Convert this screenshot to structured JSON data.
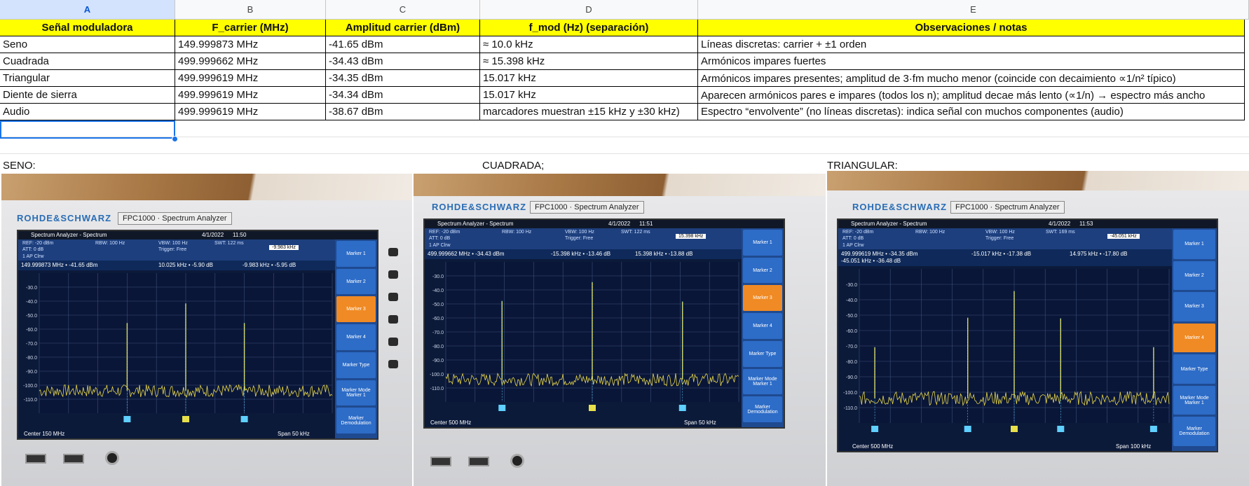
{
  "sheet": {
    "columns": [
      "A",
      "B",
      "C",
      "D",
      "E"
    ],
    "headers": [
      "Señal moduladora",
      "F_carrier (MHz)",
      "Amplitud carrier (dBm)",
      "f_mod (Hz) (separación)",
      "Observaciones / notas"
    ],
    "rows": [
      [
        "Seno",
        "149.999873 MHz",
        "-41.65 dBm",
        "≈ 10.0 kHz",
        "Líneas discretas: carrier + ±1 orden"
      ],
      [
        "Cuadrada",
        "499.999662 MHz",
        "-34.43 dBm",
        "≈ 15.398 kHz",
        "Armónicos impares fuertes"
      ],
      [
        "Triangular",
        "499.999619 MHz",
        "-34.35 dBm",
        "15.017 kHz",
        "Armónicos impares presentes; amplitud de 3·fm mucho menor (coincide con decaimiento ∝1/n² típico)"
      ],
      [
        "Diente de sierra",
        "499.999619 MHz",
        "-34.34 dBm",
        "15.017 kHz",
        "Aparecen armónicos pares e impares (todos los n); amplitud decae más lento (∝1/n) → espectro más ancho"
      ],
      [
        "Audio",
        "499.999619 MHz",
        "-38.67 dBm",
        "marcadores muestran ±15 kHz y ±30 kHz)",
        "Espectro “envolvente” (no líneas discretas): indica señal con muchos componentes (audio)"
      ]
    ],
    "captions": [
      "SENO:",
      "CUADRADA;",
      "TRIANGULAR:"
    ]
  },
  "photos": [
    {
      "brand": "ROHDE&SCHWARZ",
      "model": "FPC1000 · Spectrum Analyzer",
      "title": "Spectrum Analyzer - Spectrum",
      "date": "4/1/2022",
      "time": "11:50",
      "ref": "-20 dBm",
      "att": "0 dB",
      "rbw": "100 Hz",
      "vbw": "100 Hz",
      "swt": "122 ms",
      "trigger": "Free",
      "trace": "1 AP Clrw",
      "marker_readout": "149.999873 MHz • -41.65 dBm",
      "delta2": "10.025 kHz • -5.90 dB",
      "delta3": "-9.983 kHz • -5.95 dB",
      "field": "-9.983 kHz",
      "center": "Center 150 MHz",
      "span": "Span 50 kHz",
      "yticks": [
        "-30.0",
        "-40.0",
        "-50.0",
        "-60.0",
        "-70.0",
        "-80.0",
        "-90.0",
        "-100.0",
        "-110.0"
      ],
      "menu": [
        "Marker 1",
        "Marker 2",
        "Marker 3",
        "Marker 4",
        "Marker Type",
        "Marker Mode Marker 1",
        "Marker Demodulation"
      ],
      "active": 2,
      "peaks_dbm": [
        -55.6,
        -41.65,
        -55.6
      ],
      "peak_offsets_khz": [
        -10,
        0,
        10
      ],
      "span_khz": 50
    },
    {
      "brand": "ROHDE&SCHWARZ",
      "model": "FPC1000 · Spectrum Analyzer",
      "title": "Spectrum Analyzer - Spectrum",
      "date": "4/1/2022",
      "time": "11:51",
      "ref": "-20 dBm",
      "att": "0 dB",
      "rbw": "100 Hz",
      "vbw": "100 Hz",
      "swt": "122 ms",
      "trigger": "Free",
      "trace": "1 AP Clrw",
      "marker_readout": "499.999662 MHz • -34.43 dBm",
      "delta2": "-15.398 kHz • -13.46 dB",
      "delta3": "15.398 kHz • -13.88 dB",
      "field": "15.398 kHz",
      "center": "Center 500 MHz",
      "span": "Span 50 kHz",
      "yticks": [
        "-30.0",
        "-40.0",
        "-50.0",
        "-60.0",
        "-70.0",
        "-80.0",
        "-90.0",
        "-100.0",
        "-110.0"
      ],
      "menu": [
        "Marker 1",
        "Marker 2",
        "Marker 3",
        "Marker 4",
        "Marker Type",
        "Marker Mode Marker 1",
        "Marker Demodulation"
      ],
      "active": 2,
      "peaks_dbm": [
        -47.9,
        -34.43,
        -48.3
      ],
      "peak_offsets_khz": [
        -15.4,
        0,
        15.4
      ],
      "span_khz": 50
    },
    {
      "brand": "ROHDE&SCHWARZ",
      "model": "FPC1000 · Spectrum Analyzer",
      "title": "Spectrum Analyzer - Spectrum",
      "date": "4/1/2022",
      "time": "11:53",
      "ref": "-20 dBm",
      "att": "0 dB",
      "rbw": "100 Hz",
      "vbw": "100 Hz",
      "swt": "169 ms",
      "trigger": "Free",
      "trace": "1 AP Clrw",
      "marker_readout": "499.999619 MHz • -34.35 dBm",
      "delta2": "-15.017 kHz • -17.38 dB",
      "delta3": "14.975 kHz • -17.80 dB",
      "delta4": "-45.051 kHz • -36.48 dB",
      "field": "-45.051 kHz",
      "center": "Center 500 MHz",
      "span": "Span 100 kHz",
      "yticks": [
        "-30.0",
        "-40.0",
        "-50.0",
        "-60.0",
        "-70.0",
        "-80.0",
        "-90.0",
        "-100.0",
        "-110.0"
      ],
      "menu": [
        "Marker 1",
        "Marker 2",
        "Marker 3",
        "Marker 4",
        "Marker Type",
        "Marker Mode Marker 1",
        "Marker Demodulation"
      ],
      "active": 3,
      "peaks_dbm": [
        -70.8,
        -51.7,
        -34.35,
        -52.1,
        -70.8
      ],
      "peak_offsets_khz": [
        -45,
        -15,
        0,
        15,
        45
      ],
      "span_khz": 100
    }
  ]
}
